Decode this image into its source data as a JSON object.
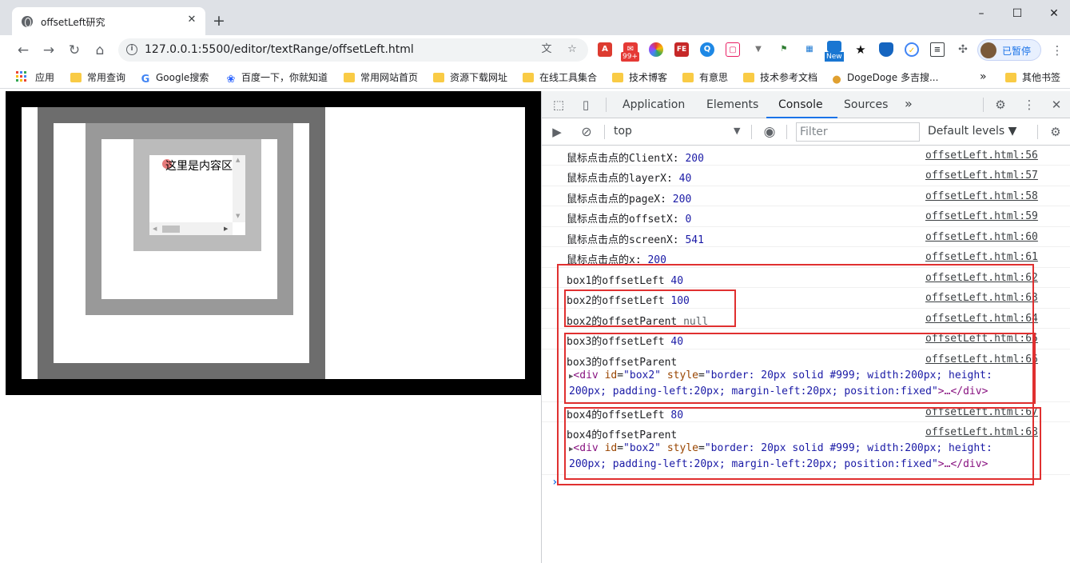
{
  "browser": {
    "tab_title": "offsetLeft研究",
    "tab_close": "✕",
    "new_tab": "+",
    "window_controls": [
      "–",
      "☐",
      "✕"
    ],
    "url": "127.0.0.1:5500/editor/textRange/offsetLeft.html",
    "ext_badge": "99+",
    "ext_new_badge": "New",
    "profile_label": "已暂停",
    "bookmarks": [
      "应用",
      "常用查询",
      "Google搜索",
      "百度一下，你就知道",
      "常用网站首页",
      "资源下载网址",
      "在线工具集合",
      "技术博客",
      "有意思",
      "技术参考文档",
      "DogeDoge 多吉搜...",
      "其他书签"
    ],
    "bookmarks_more": "»"
  },
  "page": {
    "box4_content": "这里是内容区"
  },
  "devtools": {
    "tabs": [
      "Application",
      "Elements",
      "Console",
      "Sources"
    ],
    "more_tabs": "»",
    "context": "top",
    "filter_placeholder": "Filter",
    "levels": "Default levels ▼",
    "logs": [
      {
        "label": "鼠标点击点的ClientX:",
        "value": "200",
        "src": "offsetLeft.html:56"
      },
      {
        "label": "鼠标点击点的layerX:",
        "value": "40",
        "src": "offsetLeft.html:57"
      },
      {
        "label": "鼠标点击点的pageX:",
        "value": "200",
        "src": "offsetLeft.html:58"
      },
      {
        "label": "鼠标点击点的offsetX:",
        "value": "0",
        "src": "offsetLeft.html:59"
      },
      {
        "label": "鼠标点击点的screenX:",
        "value": "541",
        "src": "offsetLeft.html:60"
      },
      {
        "label": "鼠标点击点的x:",
        "value": "200",
        "src": "offsetLeft.html:61"
      },
      {
        "label": "box1的offsetLeft",
        "value": "40",
        "src": "offsetLeft.html:62"
      },
      {
        "label": "box2的offsetLeft",
        "value": "100",
        "src": "offsetLeft.html:63"
      },
      {
        "label": "box2的offsetParent",
        "value": "null",
        "src": "offsetLeft.html:64"
      },
      {
        "label": "box3的offsetLeft",
        "value": "40",
        "src": "offsetLeft.html:65"
      },
      {
        "label": "box3的offsetParent",
        "value": "",
        "src": "offsetLeft.html:66"
      },
      {
        "label": "box4的offsetLeft",
        "value": "80",
        "src": "offsetLeft.html:67"
      },
      {
        "label": "box4的offsetParent",
        "value": "",
        "src": "offsetLeft.html:68"
      }
    ],
    "element_line1": {
      "tag_open": "<div ",
      "id_attr": "id",
      "id_val": "\"box2\"",
      "style_attr": " style",
      "style_val": "\"border: 20px solid #999; width:200px; height:"
    },
    "element_line2": {
      "style_cont": "200px; padding-left:20px; margin-left:20px; position:fixed\"",
      "tag_mid": ">…",
      "tag_close": "</div>"
    }
  }
}
